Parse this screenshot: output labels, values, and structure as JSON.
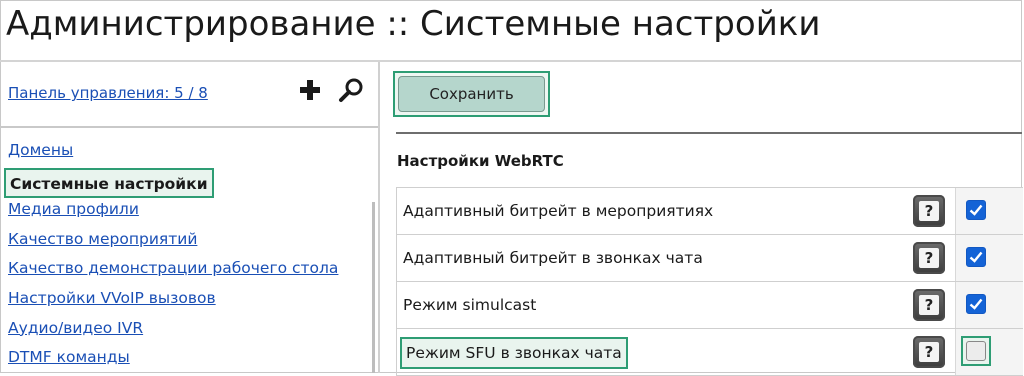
{
  "header": {
    "title": "Администрирование :: Системные настройки"
  },
  "sidebar": {
    "panel_link": "Панель управления: 5 / 8",
    "add_icon": "plus-icon",
    "search_icon": "search-icon",
    "items": [
      {
        "label": "Домены",
        "active": false
      },
      {
        "label": "Системные настройки",
        "active": true
      },
      {
        "label": "Медиа профили",
        "active": false
      },
      {
        "label": "Качество мероприятий",
        "active": false
      },
      {
        "label": "Качество демонстрации рабочего стола",
        "active": false
      },
      {
        "label": "Настройки VVoIP вызовов",
        "active": false
      },
      {
        "label": "Аудио/видео IVR",
        "active": false
      },
      {
        "label": "DTMF команды",
        "active": false
      }
    ]
  },
  "main": {
    "save_label": "Сохранить",
    "section_title": "Настройки WebRTC",
    "settings": [
      {
        "label": "Адаптивный битрейт в мероприятиях",
        "checked": true,
        "help": "?"
      },
      {
        "label": "Адаптивный битрейт в звонках чата",
        "checked": true,
        "help": "?"
      },
      {
        "label": "Режим simulcast",
        "checked": true,
        "help": "?"
      },
      {
        "label": "Режим SFU в звонках чата",
        "checked": false,
        "help": "?"
      }
    ]
  },
  "colors": {
    "link": "#1a4fb5",
    "highlight_border": "#2e9d74",
    "checkbox_on": "#1463d6",
    "save_button_bg": "#b5d6cc"
  }
}
